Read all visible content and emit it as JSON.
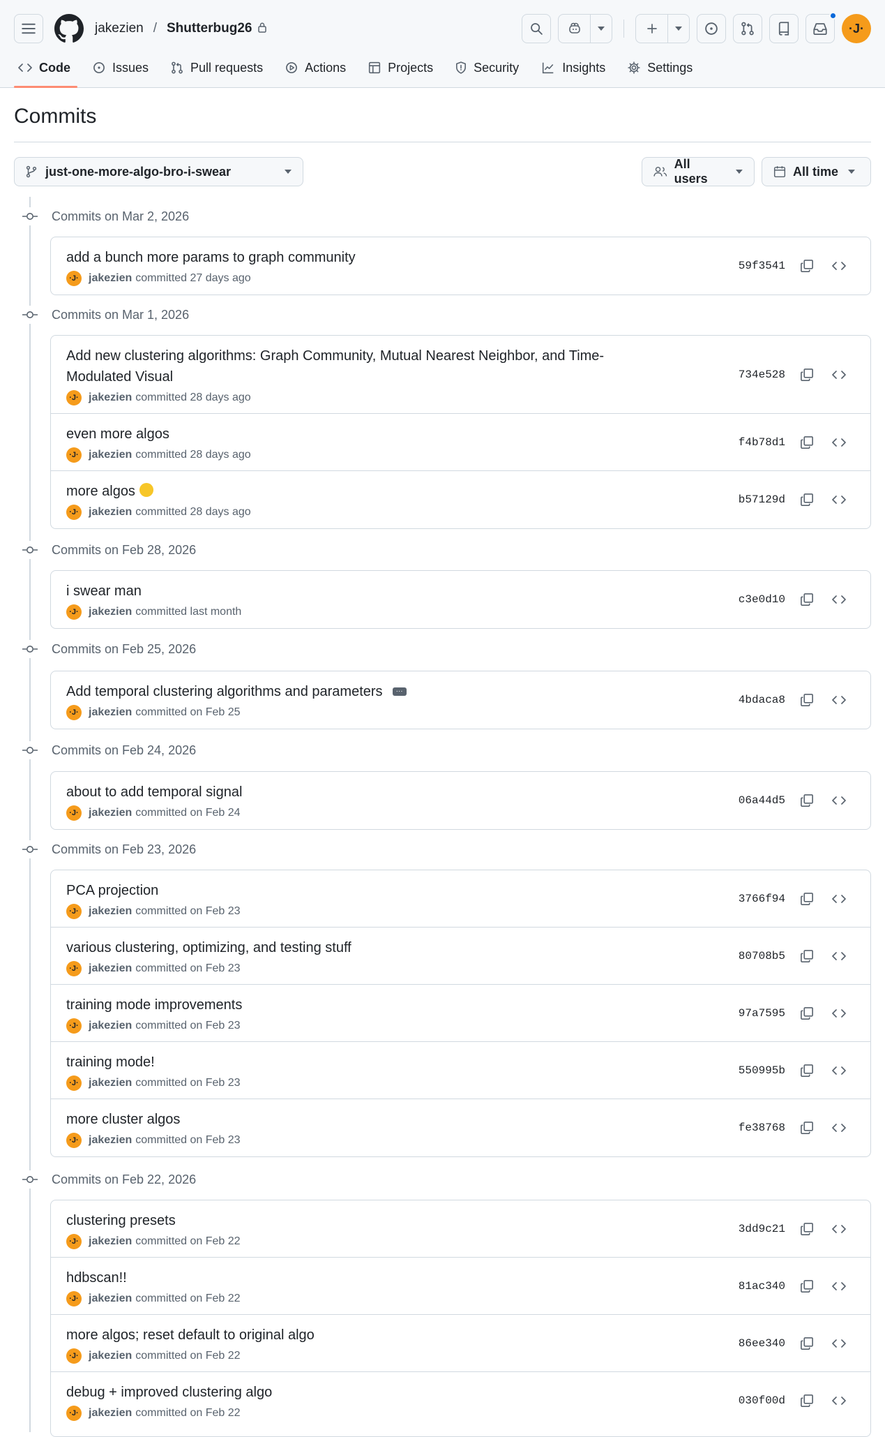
{
  "header": {
    "owner": "jakezien",
    "separator": "/",
    "repo": "Shutterbug26"
  },
  "user_avatar_initials": "·J·",
  "tabs": [
    {
      "label": "Code",
      "icon": "code-icon",
      "active": true
    },
    {
      "label": "Issues",
      "icon": "issue-opened-icon"
    },
    {
      "label": "Pull requests",
      "icon": "git-pull-request-icon"
    },
    {
      "label": "Actions",
      "icon": "play-icon"
    },
    {
      "label": "Projects",
      "icon": "table-icon"
    },
    {
      "label": "Security",
      "icon": "shield-icon"
    },
    {
      "label": "Insights",
      "icon": "graph-icon"
    },
    {
      "label": "Settings",
      "icon": "gear-icon"
    }
  ],
  "page": {
    "title": "Commits"
  },
  "filters": {
    "branch": "just-one-more-algo-bro-i-swear",
    "users": "All users",
    "time": "All time"
  },
  "colors": {
    "accent_tab": "#fd8c73",
    "avatar": "#f59b1b",
    "notification": "#0969da"
  },
  "groups": [
    {
      "date": "Commits on Mar 2, 2026",
      "commits": [
        {
          "message": "add a bunch more params to graph community",
          "author": "jakezien",
          "when": "committed 27 days ago",
          "sha": "59f3541"
        }
      ]
    },
    {
      "date": "Commits on Mar 1, 2026",
      "commits": [
        {
          "message": "Add new clustering algorithms: Graph Community, Mutual Nearest Neighbor, and Time-Modulated Visual",
          "author": "jakezien",
          "when": "committed 28 days ago",
          "sha": "734e528"
        },
        {
          "message": "even more algos",
          "author": "jakezien",
          "when": "committed 28 days ago",
          "sha": "f4b78d1"
        },
        {
          "message": "more algos",
          "author": "jakezien",
          "when": "committed 28 days ago",
          "sha": "b57129d"
        }
      ]
    },
    {
      "date": "Commits on Feb 28, 2026",
      "commits": [
        {
          "message": "i swear man",
          "author": "jakezien",
          "when": "committed last month",
          "sha": "c3e0d10"
        }
      ]
    },
    {
      "date": "Commits on Feb 25, 2026",
      "commits": [
        {
          "message": "Add temporal clustering algorithms and parameters",
          "author": "jakezien",
          "when": "committed on Feb 25",
          "sha": "4bdaca8"
        }
      ]
    },
    {
      "date": "Commits on Feb 24, 2026",
      "commits": [
        {
          "message": "about to add temporal signal",
          "author": "jakezien",
          "when": "committed on Feb 24",
          "sha": "06a44d5"
        }
      ]
    },
    {
      "date": "Commits on Feb 23, 2026",
      "commits": [
        {
          "message": "PCA projection",
          "author": "jakezien",
          "when": "committed on Feb 23",
          "sha": "3766f94"
        },
        {
          "message": "various clustering, optimizing, and testing stuff",
          "author": "jakezien",
          "when": "committed on Feb 23",
          "sha": "80708b5"
        },
        {
          "message": "training mode improvements",
          "author": "jakezien",
          "when": "committed on Feb 23",
          "sha": "97a7595"
        },
        {
          "message": "training mode!",
          "author": "jakezien",
          "when": "committed on Feb 23",
          "sha": "550995b"
        },
        {
          "message": "more cluster algos",
          "author": "jakezien",
          "when": "committed on Feb 23",
          "sha": "fe38768"
        }
      ]
    },
    {
      "date": "Commits on Feb 22, 2026",
      "commits": [
        {
          "message": "clustering presets",
          "author": "jakezien",
          "when": "committed on Feb 22",
          "sha": "3dd9c21"
        },
        {
          "message": "hdbscan!!",
          "author": "jakezien",
          "when": "committed on Feb 22",
          "sha": "81ac340"
        },
        {
          "message": "more algos; reset default to original algo",
          "author": "jakezien",
          "when": "committed on Feb 22",
          "sha": "86ee340"
        },
        {
          "message": "debug + improved clustering algo",
          "author": "jakezien",
          "when": "committed on Feb 22",
          "sha": "030f00d"
        }
      ]
    }
  ]
}
